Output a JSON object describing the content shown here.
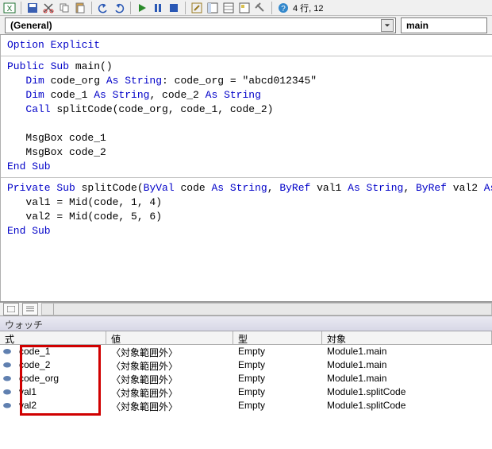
{
  "toolbar": {
    "status_text": "4 行, 12"
  },
  "dropdowns": {
    "general": "(General)",
    "procedure": "main"
  },
  "code": {
    "block1": {
      "line1": {
        "p0": "Option Explicit"
      }
    },
    "block2": {
      "l1": {
        "p0": "Public Sub",
        "p1": " main()"
      },
      "l2": {
        "p0": "   Dim",
        "p1": " code_org ",
        "p2": "As String",
        "p3": ": code_org = ",
        "p4": "\"abcd012345\""
      },
      "l3": {
        "p0": "   Dim",
        "p1": " code_1 ",
        "p2": "As String",
        "p3": ", code_2 ",
        "p4": "As String"
      },
      "l4": {
        "p0": "   Call",
        "p1": " splitCode(code_org, code_1, code_2)"
      },
      "l5": {
        "p0": "   "
      },
      "l6": {
        "p0": "   MsgBox code_1"
      },
      "l7": {
        "p0": "   MsgBox code_2"
      },
      "l8": {
        "p0": "End Sub"
      }
    },
    "block3": {
      "l1": {
        "p0": "Private Sub",
        "p1": " splitCode(",
        "p2": "ByVal",
        "p3": " code ",
        "p4": "As String",
        "p5": ", ",
        "p6": "ByRef",
        "p7": " val1 ",
        "p8": "As String",
        "p9": ", ",
        "p10": "ByRef",
        "p11": " val2 ",
        "p12": "As String",
        "p13": ")"
      },
      "l2": {
        "p0": "   val1 = Mid(code, 1, 4)"
      },
      "l3": {
        "p0": "   val2 = Mid(code, 5, 6)"
      },
      "l4": {
        "p0": "End Sub"
      }
    }
  },
  "watch": {
    "title": "ウォッチ",
    "headers": {
      "expr": "式",
      "val": "値",
      "type": "型",
      "ctx": "対象"
    },
    "rows": [
      {
        "expr": "code_1",
        "val": "〈対象範囲外〉",
        "type": "Empty",
        "ctx": "Module1.main"
      },
      {
        "expr": "code_2",
        "val": "〈対象範囲外〉",
        "type": "Empty",
        "ctx": "Module1.main"
      },
      {
        "expr": "code_org",
        "val": "〈対象範囲外〉",
        "type": "Empty",
        "ctx": "Module1.main"
      },
      {
        "expr": "val1",
        "val": "〈対象範囲外〉",
        "type": "Empty",
        "ctx": "Module1.splitCode"
      },
      {
        "expr": "val2",
        "val": "〈対象範囲外〉",
        "type": "Empty",
        "ctx": "Module1.splitCode"
      }
    ],
    "glyph": "⬬"
  }
}
